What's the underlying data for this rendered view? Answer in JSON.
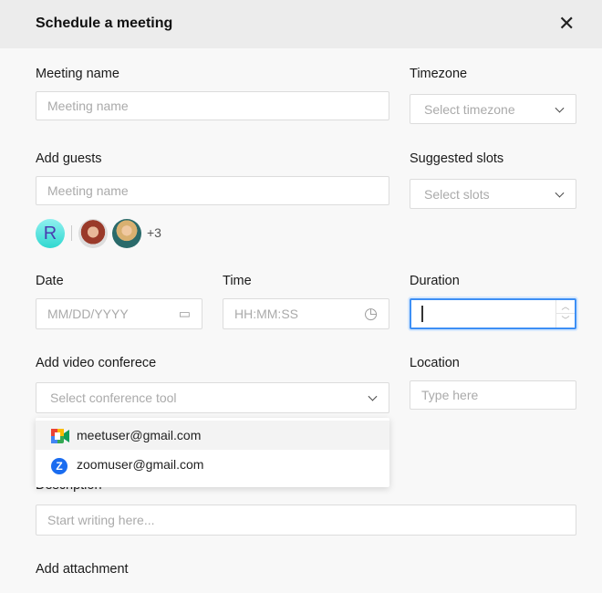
{
  "header": {
    "title": "Schedule a meeting",
    "close_icon": "close-icon"
  },
  "form": {
    "meeting_name": {
      "label": "Meeting name",
      "placeholder": "Meeting name"
    },
    "timezone": {
      "label": "Timezone",
      "placeholder": "Select timezone"
    },
    "guests": {
      "label": "Add guests",
      "placeholder": "Meeting name",
      "avatar_initial": "R",
      "more_count": "+3"
    },
    "slots": {
      "label": "Suggested slots",
      "placeholder": "Select slots"
    },
    "date": {
      "label": "Date",
      "placeholder": "MM/DD/YYYY"
    },
    "time": {
      "label": "Time",
      "placeholder": "HH:MM:SS"
    },
    "duration": {
      "label": "Duration",
      "value": ""
    },
    "video": {
      "label": "Add video conferece",
      "placeholder": "Select conference tool",
      "options": [
        {
          "label": "meetuser@gmail.com",
          "icon": "google-meet-icon"
        },
        {
          "label": "zoomuser@gmail.com",
          "icon": "zoom-icon"
        }
      ]
    },
    "location": {
      "label": "Location",
      "placeholder": "Type here"
    },
    "description": {
      "label": "Description",
      "placeholder": "Start writing here..."
    },
    "attachment": {
      "label": "Add attachment"
    }
  },
  "colors": {
    "focus": "#3d8ff5",
    "zoom": "#1a6cf0"
  }
}
